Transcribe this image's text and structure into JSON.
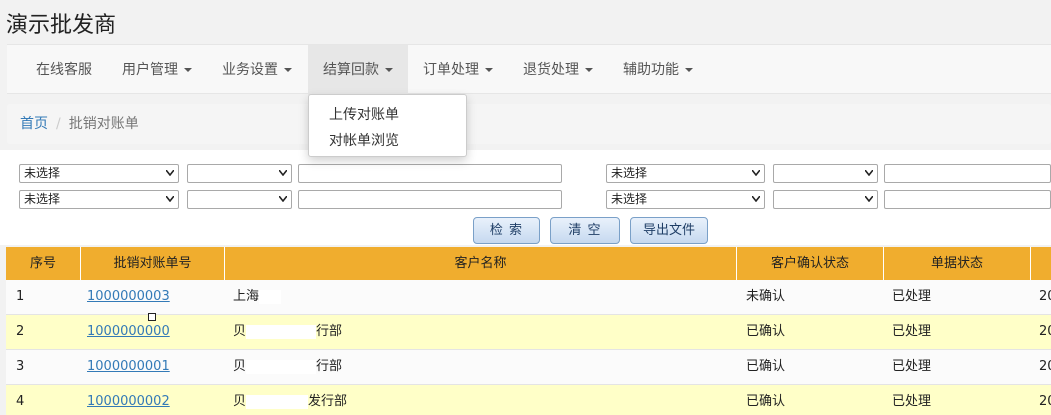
{
  "app": {
    "title": "演示批发商"
  },
  "nav": {
    "items": [
      {
        "label": "在线客服",
        "has_caret": false
      },
      {
        "label": "用户管理",
        "has_caret": true
      },
      {
        "label": "业务设置",
        "has_caret": true
      },
      {
        "label": "结算回款",
        "has_caret": true,
        "active": true
      },
      {
        "label": "订单处理",
        "has_caret": true
      },
      {
        "label": "退货处理",
        "has_caret": true
      },
      {
        "label": "辅助功能",
        "has_caret": true
      }
    ],
    "dropdown": [
      "上传对账单",
      "对帐单浏览"
    ]
  },
  "breadcrumb": {
    "home": "首页",
    "separator": "/",
    "current": "批销对账单"
  },
  "filters": {
    "select_default": "未选择"
  },
  "buttons": {
    "search": "检 索",
    "clear": "清 空",
    "export": "导出文件"
  },
  "table": {
    "headers": [
      "序号",
      "批销对账单号",
      "客户名称",
      "客户确认状态",
      "单据状态"
    ],
    "rows": [
      {
        "index": "1",
        "bill_no": "1000000003",
        "customer_prefix": "上海",
        "customer_suffix": "",
        "confirm": "未确认",
        "status": "已处理",
        "date_prefix": "20"
      },
      {
        "index": "2",
        "bill_no": "1000000000",
        "customer_prefix": "贝",
        "customer_suffix": "行部",
        "confirm": "已确认",
        "status": "已处理",
        "date_prefix": "20"
      },
      {
        "index": "3",
        "bill_no": "1000000001",
        "customer_prefix": "贝",
        "customer_suffix": "行部",
        "confirm": "已确认",
        "status": "已处理",
        "date_prefix": "20"
      },
      {
        "index": "4",
        "bill_no": "1000000002",
        "customer_prefix": "贝",
        "customer_suffix": "发行部",
        "confirm": "已确认",
        "status": "已处理",
        "date_prefix": "20"
      }
    ]
  },
  "colors": {
    "header_bg": "#f0ad2e",
    "row_even": "#ffffc8",
    "link": "#337ab7"
  }
}
